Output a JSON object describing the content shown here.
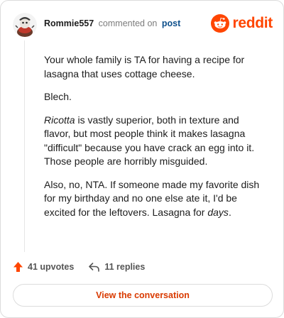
{
  "comment": {
    "username": "Rommie557",
    "verb": "commented on",
    "post_link": "post",
    "paragraphs": {
      "p1": "Your whole family is TA for having a recipe for lasagna that uses cottage cheese.",
      "p2": "Blech.",
      "p3_em": "Ricotta",
      "p3_rest": " is vastly superior, both in texture and flavor, but most people think it makes lasagna \"difficult\" because you have crack an egg into it. Those people are horribly misguided.",
      "p4_start": "Also, no, NTA. If someone made my favorite dish for my birthday and no one else ate it, I'd be excited for the leftovers. Lasagna for ",
      "p4_em": "days",
      "p4_end": "."
    }
  },
  "brand": {
    "wordmark": "reddit",
    "color": "#ff4500"
  },
  "actions": {
    "upvotes": "41 upvotes",
    "replies": "11 replies"
  },
  "cta": {
    "label": "View the conversation"
  },
  "icons": {
    "avatar": "avatar-icon",
    "logo": "reddit-alien-icon",
    "upvote": "upvote-arrow-icon",
    "reply": "reply-arrow-icon"
  }
}
